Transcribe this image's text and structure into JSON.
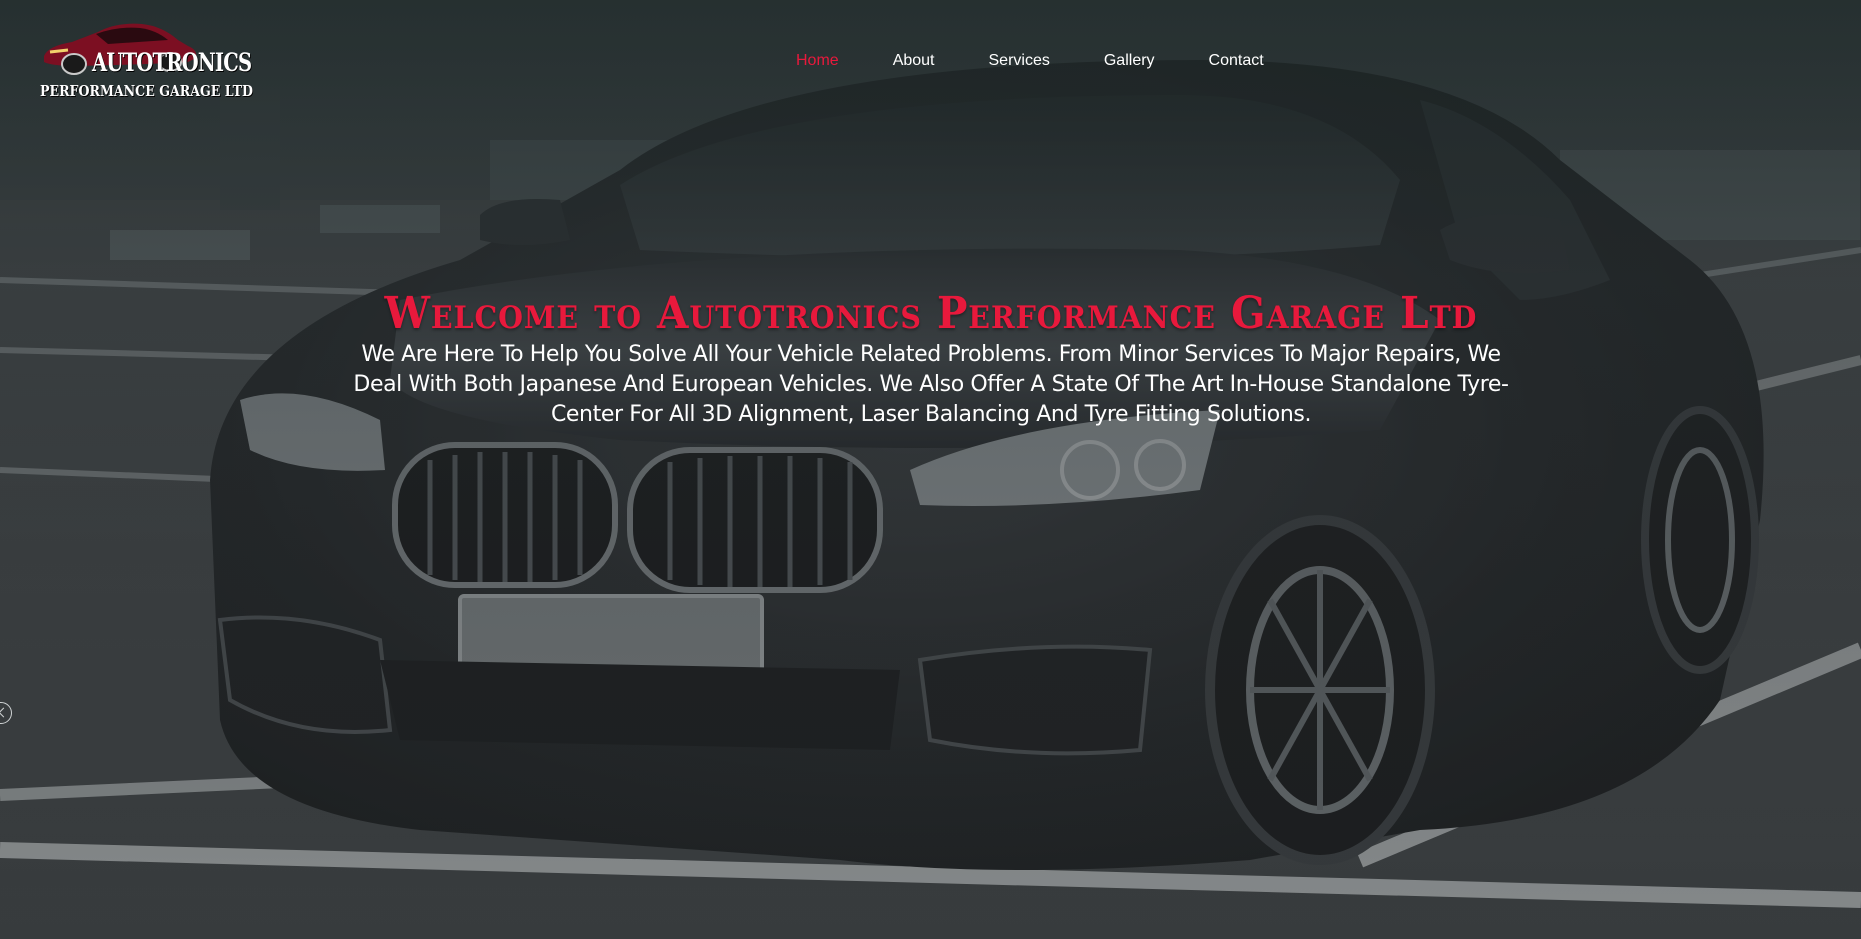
{
  "brand": {
    "logo_top": "AUTOTRONICS",
    "logo_bottom": "PERFORMANCE GARAGE LTD"
  },
  "nav": {
    "items": [
      {
        "label": "Home",
        "active": true
      },
      {
        "label": "About",
        "active": false
      },
      {
        "label": "Services",
        "active": false
      },
      {
        "label": "Gallery",
        "active": false
      },
      {
        "label": "Contact",
        "active": false
      }
    ]
  },
  "hero": {
    "title": "Welcome to Autotronics Performance Garage Ltd",
    "description": "We Are Here To Help You Solve All Your Vehicle Related Problems. From Minor Services To Major Repairs, We Deal With Both Japanese And European Vehicles. We Also Offer A State Of The Art In-House Standalone Tyre-Center For All 3D Alignment, Laser Balancing And Tyre Fitting Solutions."
  },
  "colors": {
    "accent": "#e8193c",
    "nav_text": "#ffffff",
    "hero_text": "#ffffff",
    "overlay": "#1c2022"
  },
  "icons": {
    "logo_mark": "sports-car-icon",
    "edge_handle": "chevron-left-icon"
  }
}
